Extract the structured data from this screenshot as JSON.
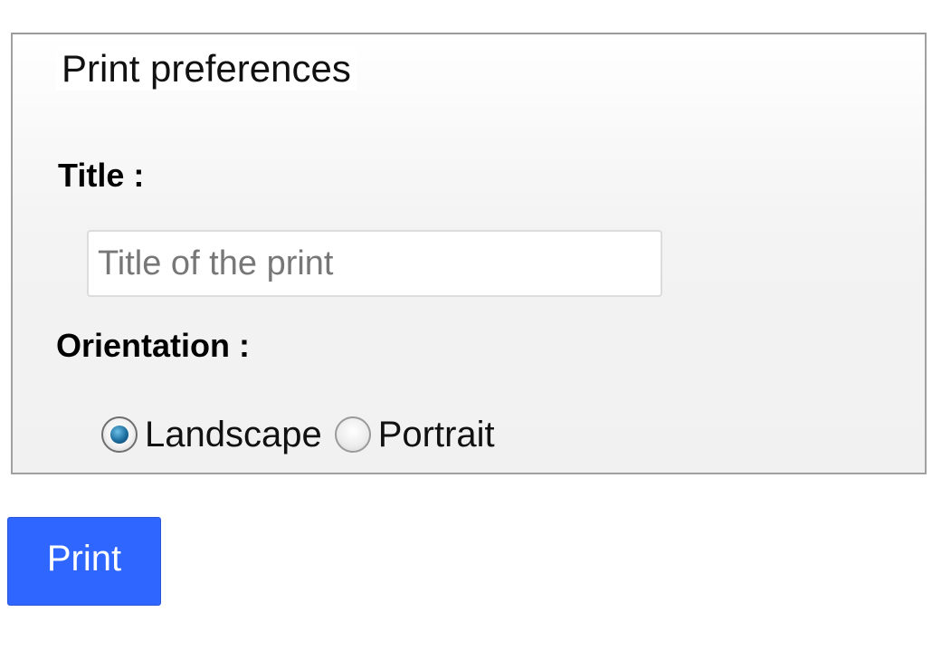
{
  "fieldset": {
    "legend": "Print preferences"
  },
  "title_field": {
    "label": "Title :",
    "placeholder": "Title of the print",
    "value": ""
  },
  "orientation": {
    "label": "Orientation :",
    "options": [
      {
        "label": "Landscape",
        "checked": true
      },
      {
        "label": "Portrait",
        "checked": false
      }
    ],
    "selected": "Landscape"
  },
  "actions": {
    "print_label": "Print"
  },
  "colors": {
    "print_button": "#2f66ff",
    "radio_selected": "#1c6e9f"
  }
}
